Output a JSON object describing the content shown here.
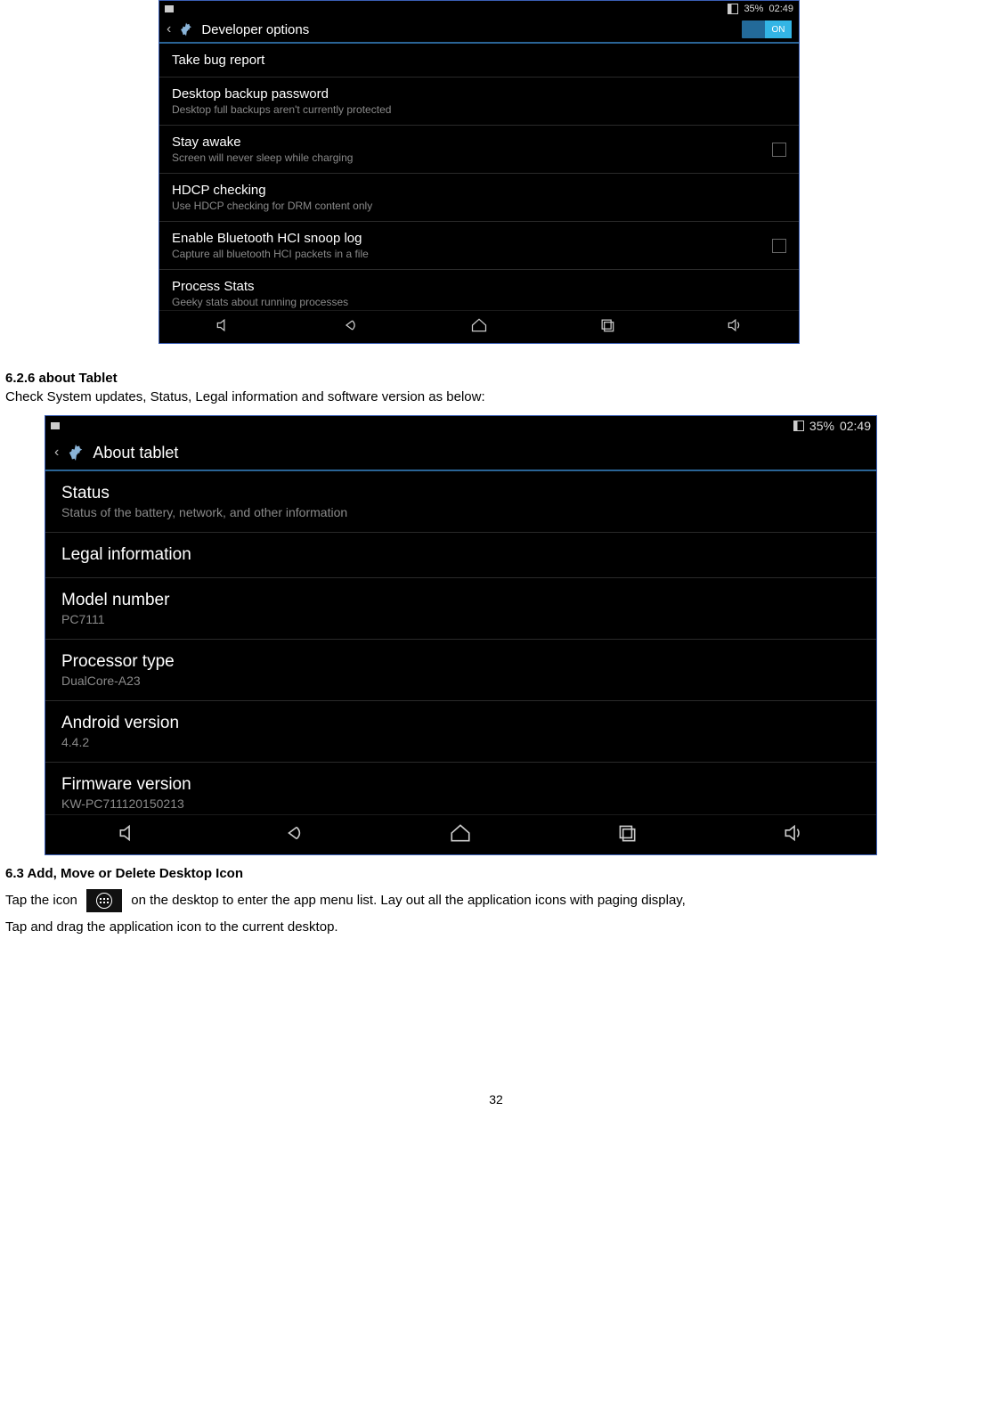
{
  "shot1": {
    "status": {
      "battery_pct": "35%",
      "time": "02:49"
    },
    "title": "Developer options",
    "switch_label": "ON",
    "items": [
      {
        "title": "Take bug report",
        "sub": ""
      },
      {
        "title": "Desktop backup password",
        "sub": "Desktop full backups aren't currently protected"
      },
      {
        "title": "Stay awake",
        "sub": "Screen will never sleep while charging",
        "checkbox": true
      },
      {
        "title": "HDCP checking",
        "sub": "Use HDCP checking for DRM content only"
      },
      {
        "title": "Enable Bluetooth HCI snoop log",
        "sub": "Capture all bluetooth HCI packets in a file",
        "checkbox": true
      },
      {
        "title": "Process Stats",
        "sub": "Geeky stats about running processes"
      }
    ]
  },
  "section626": {
    "heading": "6.2.6 about Tablet",
    "body": "Check System updates, Status, Legal information and software version as below:"
  },
  "shot2": {
    "status": {
      "battery_pct": "35%",
      "time": "02:49"
    },
    "title": "About tablet",
    "items": [
      {
        "title": "Status",
        "sub": "Status of the battery, network, and other information"
      },
      {
        "title": "Legal information",
        "sub": ""
      },
      {
        "title": "Model number",
        "sub": "PC7111"
      },
      {
        "title": "Processor type",
        "sub": "DualCore-A23"
      },
      {
        "title": "Android version",
        "sub": "4.4.2"
      },
      {
        "title": "Firmware version",
        "sub": "KW-PC711120150213"
      }
    ]
  },
  "section63": {
    "heading": "6.3 Add, Move or Delete Desktop Icon",
    "p1a": "Tap the icon",
    "p1b": "on the desktop to enter the app menu list.    Lay out all the application icons with paging display,",
    "p2": "Tap and drag the application icon to the current desktop."
  },
  "page_number": "32"
}
